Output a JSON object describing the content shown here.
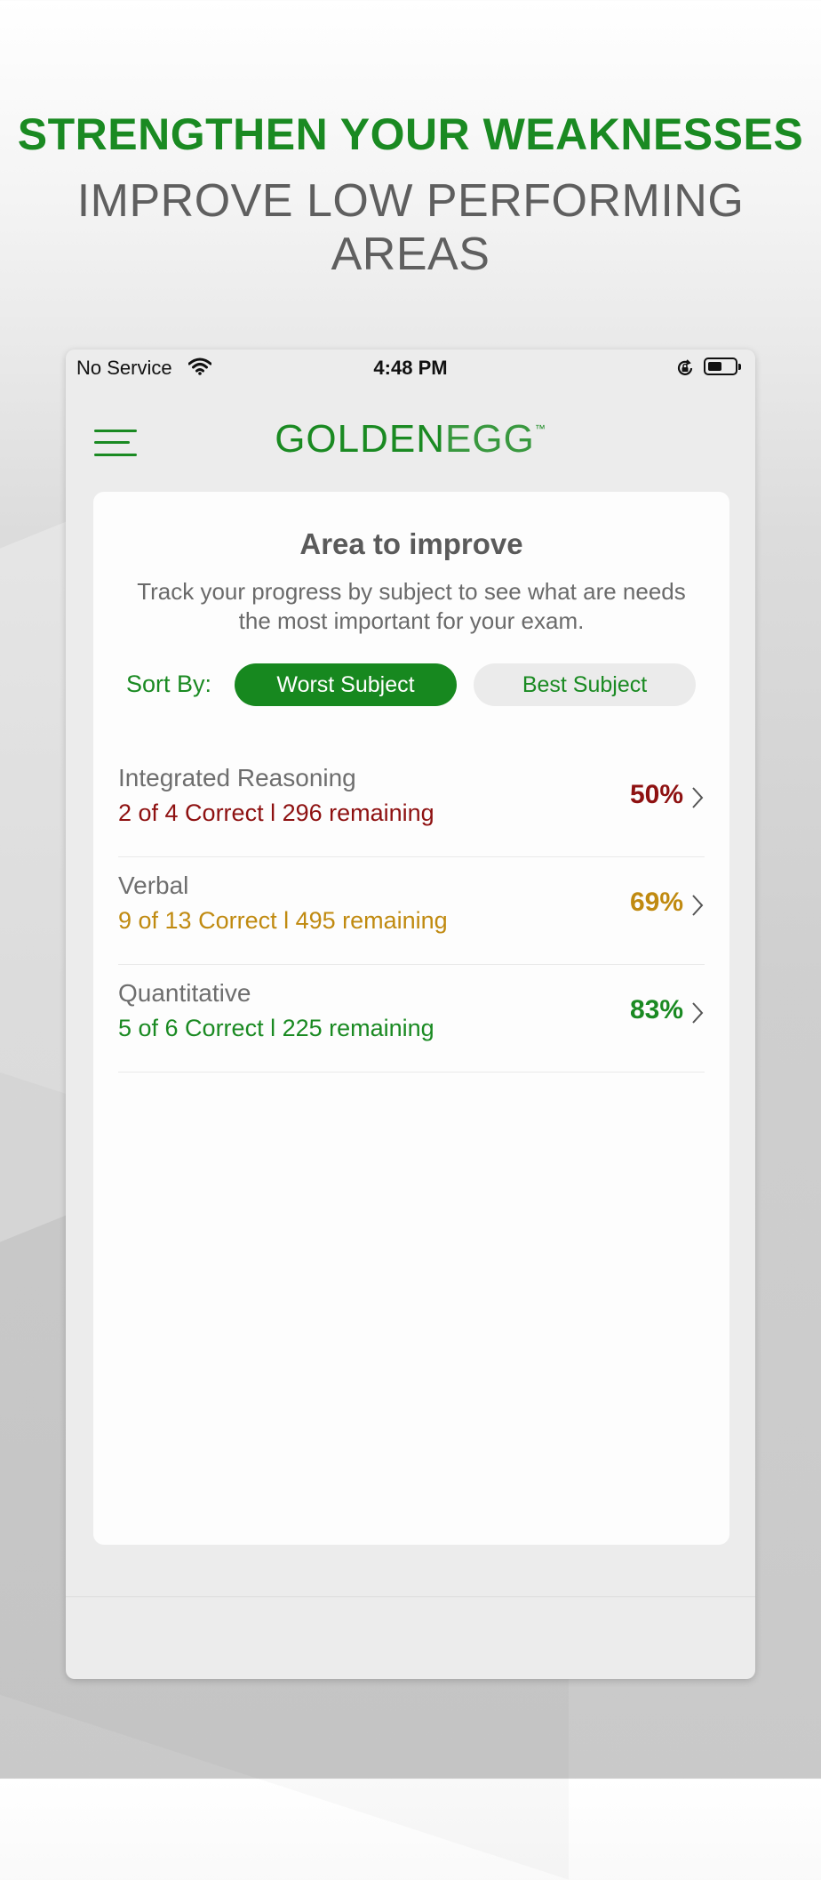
{
  "promo": {
    "headline": "STRENGTHEN YOUR WEAKNESSES",
    "subheadline": "IMPROVE LOW PERFORMING AREAS"
  },
  "status_bar": {
    "carrier": "No Service",
    "time": "4:48 PM",
    "icons": [
      "wifi-icon",
      "orientation-lock-icon",
      "battery-icon"
    ]
  },
  "app": {
    "logo_strong": "GOLDEN",
    "logo_light": "EGG",
    "logo_tm": "™",
    "menu_icon": "hamburger-menu-icon"
  },
  "card": {
    "title": "Area to improve",
    "description": "Track your progress by subject to see what are needs the most important for your exam.",
    "sort_label": "Sort By:",
    "sort_options": [
      {
        "label": "Worst Subject",
        "selected": true
      },
      {
        "label": "Best Subject",
        "selected": false
      }
    ]
  },
  "subjects": [
    {
      "name": "Integrated Reasoning",
      "stats": "2 of 4  Correct l 296 remaining",
      "percent": "50%",
      "color": "#8e1111"
    },
    {
      "name": "Verbal",
      "stats": "9 of 13  Correct l 495 remaining",
      "percent": "69%",
      "color": "#c08a10"
    },
    {
      "name": "Quantitative",
      "stats": "5 of 6  Correct l 225 remaining",
      "percent": "83%",
      "color": "#1a8a22"
    }
  ],
  "colors": {
    "brand_green": "#1a8a22",
    "weak_red": "#8e1111",
    "mid_amber": "#c08a10"
  }
}
